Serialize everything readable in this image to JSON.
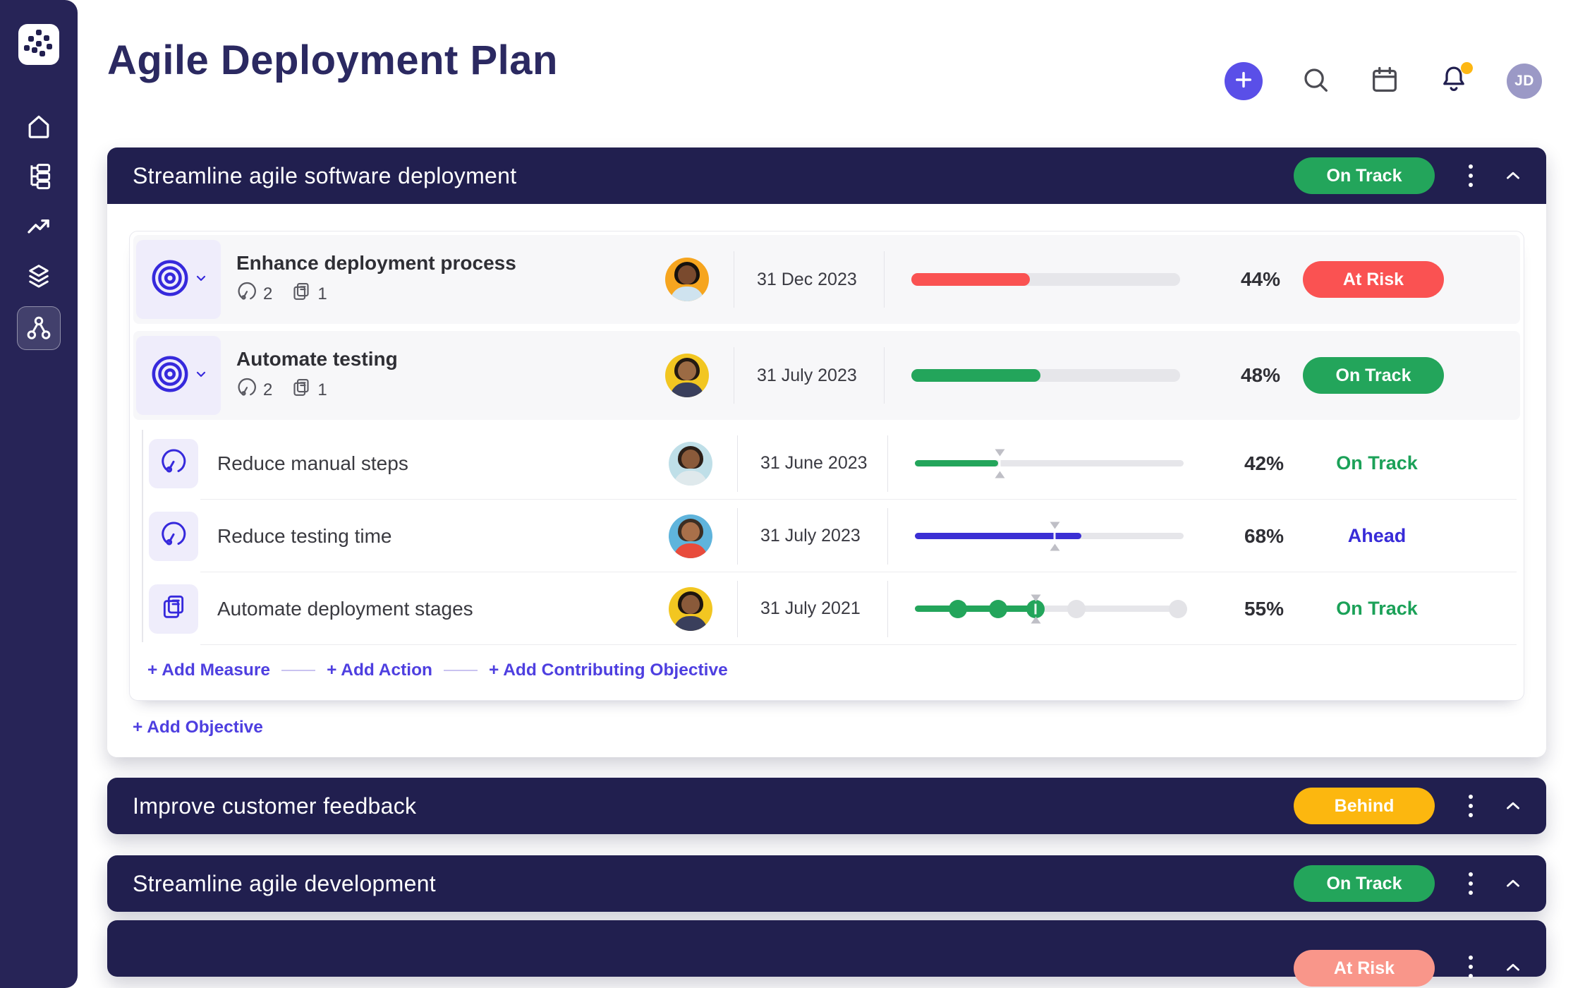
{
  "header": {
    "title": "Agile Deployment Plan",
    "avatar_initials": "JD"
  },
  "colors": {
    "accent": "#4E3FE0",
    "navy": "#211F4F",
    "green": "#23A55B",
    "red": "#FA5252",
    "yellow": "#FCB70F",
    "salmon": "#F9968A",
    "ahead_blue": "#382BD8"
  },
  "sections": [
    {
      "title": "Streamline agile software deployment",
      "status": {
        "label": "On Track",
        "color": "#23A55B"
      },
      "add_links": {
        "measure": "+ Add Measure",
        "action": "+ Add Action",
        "contributing": "+ Add Contributing Objective"
      },
      "add_objective": "+ Add Objective",
      "rows": [
        {
          "title": "Enhance deployment process",
          "kpi_count": "2",
          "initiative_count": "1",
          "due": "31 Dec 2023",
          "percent": "44%",
          "status": {
            "label": "At Risk",
            "color": "#FA5252"
          },
          "progress": {
            "fill": 44,
            "color": "#FA5252"
          },
          "avatar": {
            "bg": "#F6A51F",
            "skin": "#7A4A2E",
            "hair": "#17120E",
            "shirt": "#CFE3EF"
          }
        },
        {
          "title": "Automate testing",
          "kpi_count": "2",
          "initiative_count": "1",
          "due": "31 July 2023",
          "percent": "48%",
          "status": {
            "label": "On Track",
            "color": "#23A55B"
          },
          "progress": {
            "fill": 48,
            "color": "#23A55B"
          },
          "avatar": {
            "bg": "#F2C621",
            "skin": "#9C6B44",
            "hair": "#241A12",
            "shirt": "#3A3F5C"
          }
        },
        {
          "title": "Reduce manual steps",
          "due": "31 June 2023",
          "percent": "42%",
          "status": {
            "label": "On Track",
            "color": "#1BA158"
          },
          "progress": {
            "fill": 31,
            "color": "#23A55B",
            "marker": 31.5
          },
          "avatar": {
            "bg": "#BFDFE8",
            "skin": "#8A5A3A",
            "hair": "#2B1F18",
            "shirt": "#DFE9EC"
          }
        },
        {
          "title": "Reduce testing time",
          "due": "31 July 2023",
          "percent": "68%",
          "status": {
            "label": "Ahead",
            "color": "#382BD8"
          },
          "progress": {
            "fill": 62,
            "color": "#3B2FD4",
            "marker": 52
          },
          "avatar": {
            "bg": "#5FB4DC",
            "skin": "#A9704A",
            "hair": "#3C2E23",
            "shirt": "#E84B3C"
          }
        },
        {
          "title": "Automate deployment stages",
          "due": "31 July 2021",
          "percent": "55%",
          "status": {
            "label": "On Track",
            "color": "#1BA158"
          },
          "progress": {
            "fill": 45,
            "color": "#23A55B",
            "marker": 45,
            "dots": [
              {
                "pct": 16,
                "color": "#23A55B"
              },
              {
                "pct": 31,
                "color": "#23A55B"
              },
              {
                "pct": 45,
                "color": "#23A55B"
              },
              {
                "pct": 60,
                "color": "#E3E3E7"
              },
              {
                "pct": 98,
                "color": "#E3E3E7"
              }
            ]
          },
          "avatar": {
            "bg": "#F2C621",
            "skin": "#8A5A3A",
            "hair": "#1D150F",
            "shirt": "#3A3F5C"
          }
        }
      ]
    },
    {
      "title": "Improve customer feedback",
      "status": {
        "label": "Behind",
        "color": "#FCB70F"
      }
    },
    {
      "title": "Streamline agile development",
      "status": {
        "label": "On Track",
        "color": "#23A55B"
      }
    },
    {
      "title": "",
      "status": {
        "label": "At Risk",
        "color": "#F9968A"
      }
    }
  ]
}
